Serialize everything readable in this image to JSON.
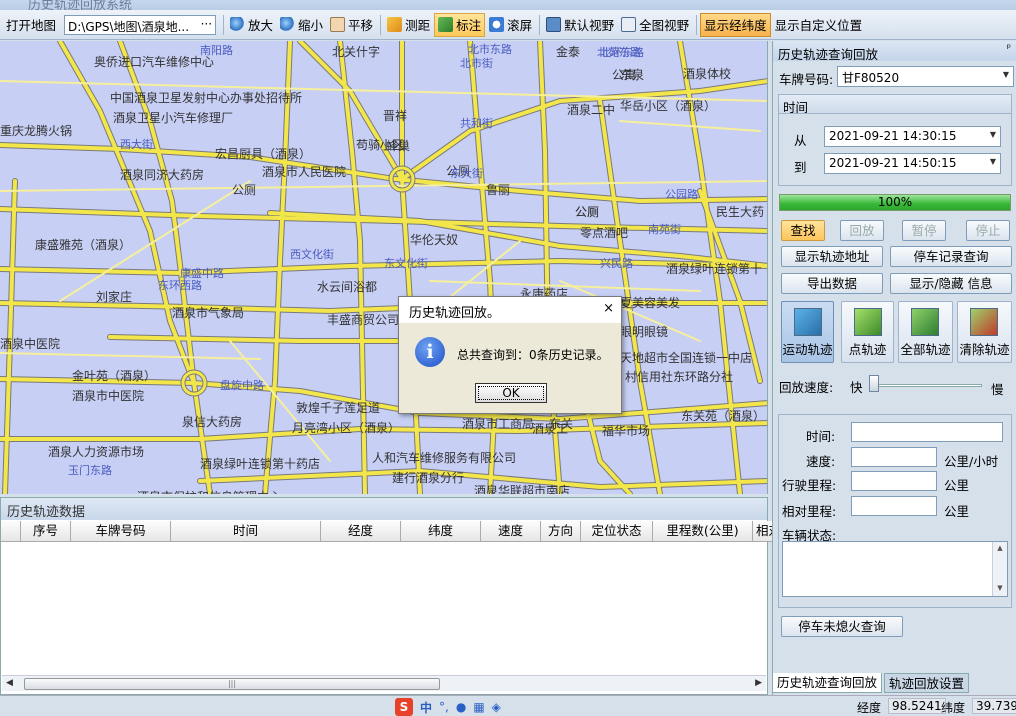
{
  "window": {
    "title": "历史轨迹回放系统"
  },
  "toolbar": {
    "open_map": "打开地图",
    "path": "D:\\GPS\\地图\\酒泉地...",
    "path_more": "···",
    "zoom_in": "放大",
    "zoom_out": "缩小",
    "pan": "平移",
    "measure": "测距",
    "mark": "标注",
    "scroll_screen": "滚屏",
    "default_view": "默认视野",
    "full_view": "全图视野",
    "show_latlon": "显示经纬度",
    "show_custom_pos": "显示自定义位置"
  },
  "map": {
    "labels": [
      "奥侨进口汽车维修中心",
      "中国酒泉卫星发射中心办事处招待所",
      "酒泉卫星小汽车修理厂",
      "重庆龙腾火锅",
      "宏昌厨具（酒泉）",
      "酒泉同济大药房",
      "公厕",
      "酒泉市人民医院",
      "康盛雅苑（酒泉）",
      "刘家庄",
      "酒泉市气象局",
      "水云间浴都",
      "丰盛商贸公司",
      "金叶苑（酒泉）",
      "酒泉市中医院",
      "泉信大药房",
      "月亮湾小区（酒泉）",
      "敦煌千子莲足道",
      "酒泉人力资源市场",
      "酒泉绿叶连锁第十药店",
      "人和汽车维修服务有限公司",
      "建行酒泉分行",
      "酒泉市工商局",
      "福华市场",
      "酒泉中医院",
      "酒泉体校",
      "华岳小区（酒泉）",
      "酒泉二中",
      "鲁丽",
      "公厕",
      "零点酒吧",
      "民生大药",
      "华伦天奴",
      "公厕",
      "永康药店",
      "酒泉绿叶连锁第十",
      "夏美容美发",
      "眼明眼镜",
      "天地超市全国连锁一中店",
      "村信用社东环路分社",
      "东关苑（酒泉）",
      "北苑东路",
      "北市街",
      "公园路",
      "晋祥",
      "蜂巢",
      "公厕",
      "东大街",
      "共和街",
      "西大街",
      "东环西路",
      "东文化街",
      "西文化街",
      "兴民路",
      "南苑街",
      "北关什字",
      "酒泉工",
      "东关",
      "酒泉华联超市南店",
      "酒泉市保护和信息管理中心",
      "玉门东路",
      "盘旋中路",
      "康盛中路",
      "苟骑小区",
      "公寓",
      "东泉",
      "金泰",
      "北市东路",
      "南阳路",
      "北环东路"
    ]
  },
  "dialog": {
    "title": "历史轨迹回放。",
    "close": "×",
    "icon": "i",
    "message": "总共查询到：0条历史记录。",
    "ok": "OK"
  },
  "grid": {
    "title": "历史轨迹数据",
    "columns": [
      "序号",
      "车牌号码",
      "时间",
      "经度",
      "纬度",
      "速度",
      "方向",
      "定位状态",
      "里程数(公里)",
      "相对里"
    ]
  },
  "panel": {
    "title": "历史轨迹查询回放",
    "pin": "ᵖ",
    "plate_label": "车牌号码:",
    "plate_value": "甘F80520",
    "time_group": "时间",
    "from_label": "从",
    "from_value": "2021-09-21 14:30:15",
    "to_label": "到",
    "to_value": "2021-09-21 14:50:15",
    "progress": "100%",
    "progress_value": 1.0,
    "buttons": {
      "find": "查找",
      "replay": "回放",
      "pause": "暂停",
      "stop": "停止",
      "show_addr": "显示轨迹地址",
      "stop_record": "停车记录查询",
      "export": "导出数据",
      "toggle_info": "显示/隐藏 信息"
    },
    "big_buttons": [
      "运动轨迹",
      "点轨迹",
      "全部轨迹",
      "清除轨迹"
    ],
    "speed_label": "回放速度:",
    "speed_fast": "快",
    "speed_slow": "慢",
    "info": {
      "time": "时间:",
      "speed": "速度:",
      "speed_unit": "公里/小时",
      "mileage": "行驶里程:",
      "mileage_unit": "公里",
      "rel_mileage": "相对里程:",
      "rel_unit": "公里",
      "status": "车辆状态:"
    },
    "unflameout_btn": "停车未熄火查询",
    "tabs": [
      "历史轨迹查询回放",
      "轨迹回放设置"
    ]
  },
  "status": {
    "lon_label": "经度",
    "lon_value": "98.5241",
    "lat_label": "纬度",
    "lat_value": "39.7397",
    "ime_logo": "S",
    "ime_cn": "中"
  },
  "colors": {
    "map_bg": "#c7cff5",
    "road": "#f2e64a",
    "road_edge": "#7a7a7a",
    "accent": "#ffc95a",
    "progress": "#37b737"
  }
}
